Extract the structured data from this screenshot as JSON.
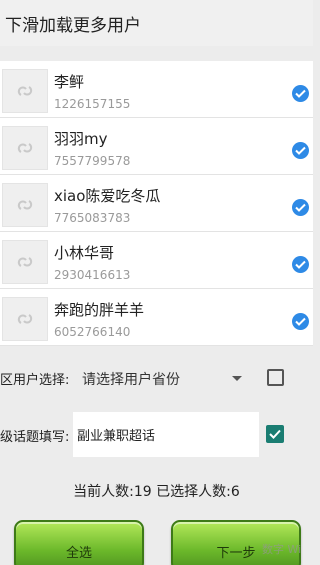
{
  "header": {
    "title": "下滑加载更多用户"
  },
  "users": [
    {
      "name": "李鲆",
      "id": "1226157155",
      "checked": true
    },
    {
      "name": "羽羽my",
      "id": "7557799578",
      "checked": true
    },
    {
      "name": "xiao陈爱吃冬瓜",
      "id": "7765083783",
      "checked": true
    },
    {
      "name": "小林华哥",
      "id": "2930416613",
      "checked": true
    },
    {
      "name": "奔跑的胖羊羊",
      "id": "6052766140",
      "checked": true
    }
  ],
  "region": {
    "label": "区用户选择:",
    "select_value": "请选择用户省份",
    "checked": false
  },
  "topic": {
    "label": "级话题填写:",
    "input_value": "副业兼职超话",
    "checked": true
  },
  "counts": {
    "current_label": "当前人数:",
    "current_value": "19",
    "selected_label": "已选择人数:",
    "selected_value": "6"
  },
  "buttons": {
    "select_all": "全选",
    "next": "下一步"
  },
  "watermark": "数字 Wi",
  "colors": {
    "check_blue": "#2e8ae6",
    "checkbox_teal": "#1a7d72",
    "button_green": "#6bb82a"
  },
  "icons": {
    "avatar": "avatar-placeholder-icon",
    "check": "check-circle-icon",
    "dropdown": "chevron-down-icon"
  }
}
